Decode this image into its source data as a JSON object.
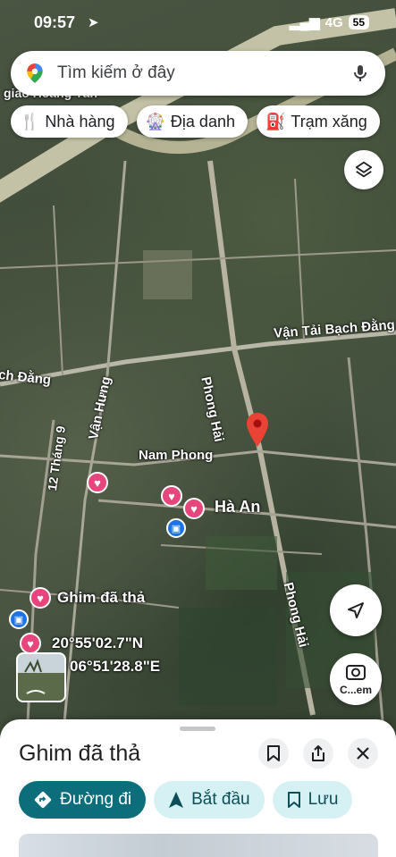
{
  "status": {
    "time": "09:57",
    "network": "4G",
    "battery": "55"
  },
  "search": {
    "placeholder": "Tìm kiếm ở đây"
  },
  "chips": [
    {
      "label": "Nhà hàng",
      "icon": "restaurant-icon"
    },
    {
      "label": "Địa danh",
      "icon": "landmark-icon"
    },
    {
      "label": "Trạm xăng",
      "icon": "gas-station-icon"
    }
  ],
  "map_labels": {
    "top_left": "giao Hoàng Tân",
    "road1": "Vận Tải Bạch Đằng",
    "road2": "ch Đằng",
    "road3": "Phong Hải",
    "road4": "Vận Hưng",
    "road5": "12 Tháng 9",
    "road6": "Nam Phong",
    "road7": "Phong Hải",
    "place": "Hà An",
    "pin_label": "Ghim đã thả",
    "lat": "20°55'02.7\"N",
    "lng": "06°51'28.8\"E"
  },
  "lens_button": {
    "label": "C...em"
  },
  "sheet": {
    "title": "Ghim đã thả",
    "actions": [
      {
        "label": "Đường đi",
        "icon": "directions-icon"
      },
      {
        "label": "Bắt đầu",
        "icon": "navigation-arrow-icon"
      },
      {
        "label": "Lưu",
        "icon": "bookmark-icon"
      }
    ]
  },
  "colors": {
    "primary": "#0b6e7a",
    "secondary": "#d6f1f3",
    "heart_pin": "#e6467b",
    "dropped_pin": "#ea4335"
  }
}
